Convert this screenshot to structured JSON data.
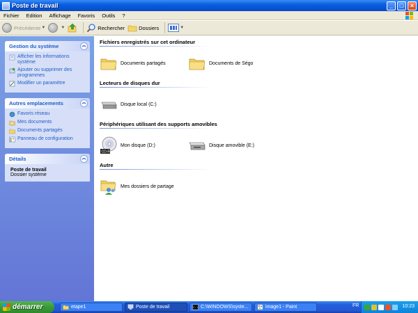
{
  "window": {
    "title": "Poste de travail"
  },
  "menu": {
    "items": [
      "Fichier",
      "Edition",
      "Affichage",
      "Favoris",
      "Outils",
      "?"
    ]
  },
  "toolbar": {
    "back_label": "Précédente",
    "search_label": "Rechercher",
    "folders_label": "Dossiers"
  },
  "sidebar": {
    "system": {
      "title": "Gestion du système",
      "items": [
        {
          "label": "Afficher les informations système",
          "icon": "system-info-icon"
        },
        {
          "label": "Ajouter ou supprimer des programmes",
          "icon": "add-remove-programs-icon"
        },
        {
          "label": "Modifier un paramètre",
          "icon": "control-panel-icon"
        }
      ]
    },
    "places": {
      "title": "Autres emplacements",
      "items": [
        {
          "label": "Favoris réseau",
          "icon": "network-icon"
        },
        {
          "label": "Mes documents",
          "icon": "documents-icon"
        },
        {
          "label": "Documents partagés",
          "icon": "shared-folder-icon"
        },
        {
          "label": "Panneau de configuration",
          "icon": "control-panel-icon"
        }
      ]
    },
    "details": {
      "title": "Détails",
      "name": "Poste de travail",
      "type": "Dossier système"
    }
  },
  "main": {
    "groups": [
      {
        "title": "Fichiers enregistrés sur cet ordinateur",
        "items": [
          {
            "label": "Documents partagés",
            "icon": "folder-icon"
          },
          {
            "label": "Documents de Ségo",
            "icon": "folder-icon"
          }
        ]
      },
      {
        "title": "Lecteurs de disques dur",
        "items": [
          {
            "label": "Disque local (C:)",
            "icon": "hard-drive-icon"
          }
        ]
      },
      {
        "title": "Périphériques utilisant des supports amovibles",
        "items": [
          {
            "label": "Mon disque (D:)",
            "icon": "cd-drive-icon",
            "badge": "CD-R"
          },
          {
            "label": "Disque amovible (E:)",
            "icon": "removable-drive-icon"
          }
        ]
      },
      {
        "title": "Autre",
        "items": [
          {
            "label": "Mes dossiers de partage",
            "icon": "shared-folders-icon"
          }
        ]
      }
    ]
  },
  "taskbar": {
    "start_label": "démarrer",
    "tasks": [
      {
        "label": "etape1",
        "icon": "folder-icon",
        "active": false
      },
      {
        "label": "Poste de travail",
        "icon": "computer-icon",
        "active": true
      },
      {
        "label": "C:\\WINDOWS\\syste...",
        "icon": "console-icon",
        "active": false
      },
      {
        "label": "image1 - Paint",
        "icon": "paint-icon",
        "active": false
      }
    ],
    "language": "FR",
    "clock": "10:23"
  },
  "colors": {
    "title_bar": "#0a5fe0",
    "sidebar_link": "#215dc6",
    "taskbar": "#245edc",
    "start_button": "#3c9a39"
  }
}
